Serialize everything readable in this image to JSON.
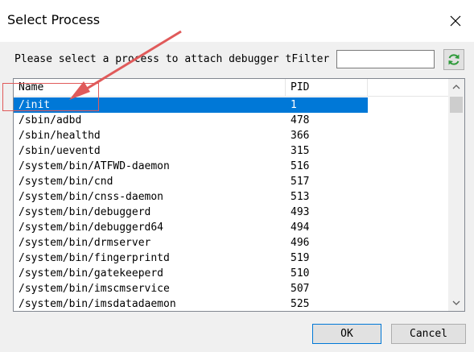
{
  "window": {
    "title": "Select Process"
  },
  "prompt": {
    "text": "Please select a process to attach debugger tFilter",
    "filter_value": ""
  },
  "table": {
    "columns": [
      "Name",
      "PID"
    ],
    "rows": [
      {
        "name": "/init",
        "pid": "1"
      },
      {
        "name": "/sbin/adbd",
        "pid": "478"
      },
      {
        "name": "/sbin/healthd",
        "pid": "366"
      },
      {
        "name": "/sbin/ueventd",
        "pid": "315"
      },
      {
        "name": "/system/bin/ATFWD-daemon",
        "pid": "516"
      },
      {
        "name": "/system/bin/cnd",
        "pid": "517"
      },
      {
        "name": "/system/bin/cnss-daemon",
        "pid": "513"
      },
      {
        "name": "/system/bin/debuggerd",
        "pid": "493"
      },
      {
        "name": "/system/bin/debuggerd64",
        "pid": "494"
      },
      {
        "name": "/system/bin/drmserver",
        "pid": "496"
      },
      {
        "name": "/system/bin/fingerprintd",
        "pid": "519"
      },
      {
        "name": "/system/bin/gatekeeperd",
        "pid": "510"
      },
      {
        "name": "/system/bin/imscmservice",
        "pid": "507"
      },
      {
        "name": "/system/bin/imsdatadaemon",
        "pid": "525"
      }
    ],
    "selected_index": 0
  },
  "buttons": {
    "ok": "OK",
    "cancel": "Cancel"
  },
  "colors": {
    "selection": "#0078d7",
    "annotation": "#e05a5a"
  },
  "icons": {
    "close": "close-icon",
    "refresh": "refresh-icon",
    "scroll_up": "chevron-up-icon",
    "scroll_down": "chevron-down-icon"
  }
}
